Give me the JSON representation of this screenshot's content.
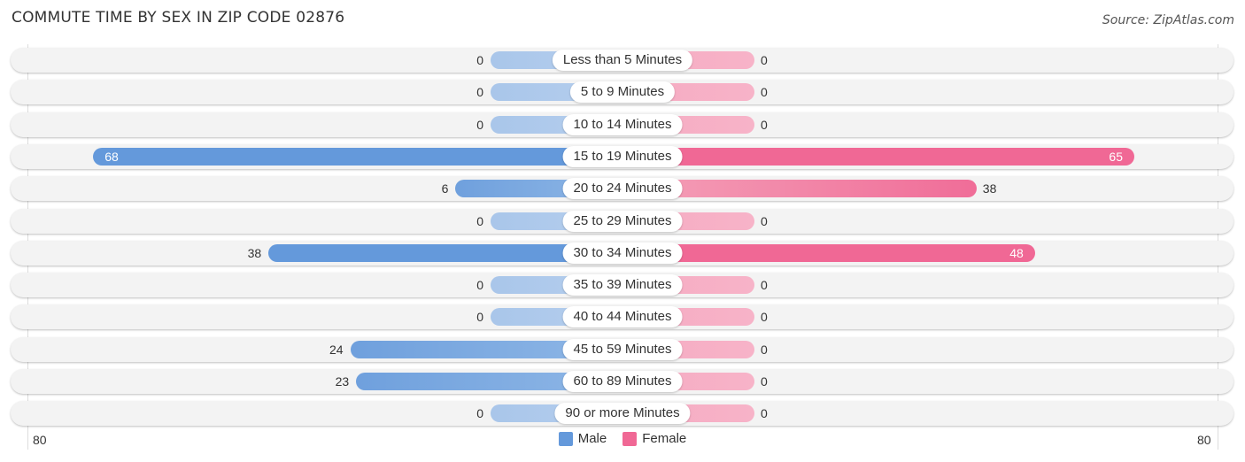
{
  "header": {
    "title": "COMMUTE TIME BY SEX IN ZIP CODE 02876",
    "source": "Source: ZipAtlas.com"
  },
  "colors": {
    "male": "#6499db",
    "female": "#f06895"
  },
  "chart_data": {
    "type": "bar",
    "orientation": "horizontal-diverging",
    "title": "COMMUTE TIME BY SEX IN ZIP CODE 02876",
    "categories": [
      "Less than 5 Minutes",
      "5 to 9 Minutes",
      "10 to 14 Minutes",
      "15 to 19 Minutes",
      "20 to 24 Minutes",
      "25 to 29 Minutes",
      "30 to 34 Minutes",
      "35 to 39 Minutes",
      "40 to 44 Minutes",
      "45 to 59 Minutes",
      "60 to 89 Minutes",
      "90 or more Minutes"
    ],
    "series": [
      {
        "name": "Male",
        "side": "left",
        "values": [
          0,
          0,
          0,
          68,
          6,
          0,
          38,
          0,
          0,
          24,
          23,
          0
        ]
      },
      {
        "name": "Female",
        "side": "right",
        "values": [
          0,
          0,
          0,
          65,
          38,
          0,
          48,
          0,
          0,
          0,
          0,
          0
        ]
      }
    ],
    "axis": {
      "left_label": "80",
      "right_label": "80",
      "range": [
        0,
        80
      ]
    },
    "legend": {
      "position": "bottom-center",
      "entries": [
        "Male",
        "Female"
      ]
    },
    "xlabel": "",
    "ylabel": ""
  }
}
